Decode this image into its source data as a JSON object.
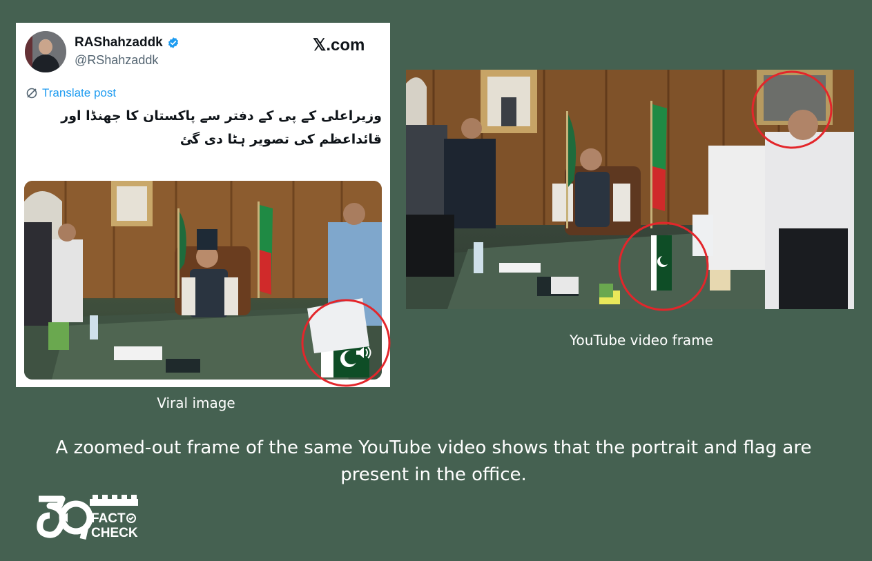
{
  "tweet": {
    "display_name": "RAShahzaddk",
    "handle": "@RShahzaddk",
    "site": "𝕏.com",
    "translate_label": "Translate post",
    "text": "وزیراعلی کے پی کے دفتر سے پاکستان کا جھنڈا اور قائداعظم کی تصویر ہٹا دی گئ"
  },
  "captions": {
    "viral": "Viral image",
    "youtube": "YouTube video frame",
    "main": "A zoomed-out frame of the same YouTube video shows that the portrait and flag are present in the office."
  },
  "logo": {
    "line1": "FACT",
    "line2": "CHECK"
  },
  "colors": {
    "background": "#456151",
    "highlight_circle": "#e3262b",
    "link_blue": "#1d9bf0",
    "verified_blue": "#1d9bf0"
  }
}
